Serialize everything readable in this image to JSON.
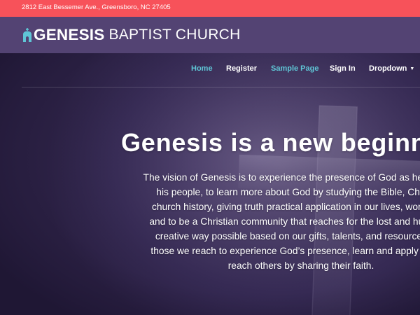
{
  "topbar": {
    "address": "2812 East Bessemer Ave., Greensboro, NC 27405"
  },
  "brand": {
    "name_bold": "GENESIS",
    "name_rest": "BAPTIST CHURCH",
    "logo_icon": "church-icon"
  },
  "nav": {
    "items": [
      {
        "label": "Home",
        "active": true
      },
      {
        "label": "Register",
        "active": false
      },
      {
        "label": "Sample Page",
        "active": false
      },
      {
        "label": "Sign In",
        "active": false
      },
      {
        "label": "Dropdown",
        "active": false
      }
    ],
    "dropdown_icon": "caret-down-icon"
  },
  "hero": {
    "title": "Genesis is a new beginning",
    "lines": [
      "The vision of Genesis is to experience the presence of God as he inhabits",
      "his people, to learn more about God by studying the Bible, Christian",
      "church history, giving truth practical application in our lives, work, a nd",
      "and to be a Christian community that reaches for the lost and hurting in",
      "creative way possible based on our gifts, talents, and resources. We",
      "those we reach to experience God’s presence, learn and apply truth to",
      "reach others by sharing their faith."
    ]
  },
  "colors": {
    "topbar": "#f7525a",
    "brandbar": "#534373",
    "accent_teal": "#5fc6d6",
    "hero_overlay": "#3f3260"
  }
}
